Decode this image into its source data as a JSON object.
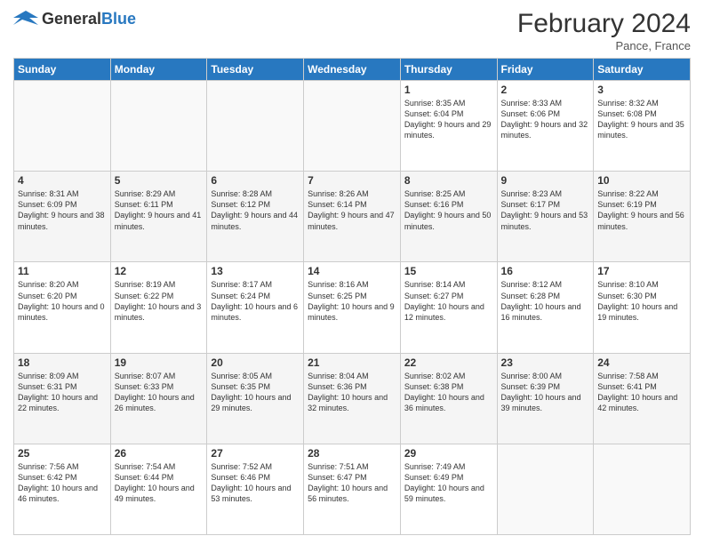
{
  "logo": {
    "general": "General",
    "blue": "Blue"
  },
  "header": {
    "month_year": "February 2024",
    "location": "Pance, France"
  },
  "weekdays": [
    "Sunday",
    "Monday",
    "Tuesday",
    "Wednesday",
    "Thursday",
    "Friday",
    "Saturday"
  ],
  "rows": [
    [
      {
        "day": "",
        "info": ""
      },
      {
        "day": "",
        "info": ""
      },
      {
        "day": "",
        "info": ""
      },
      {
        "day": "",
        "info": ""
      },
      {
        "day": "1",
        "info": "Sunrise: 8:35 AM\nSunset: 6:04 PM\nDaylight: 9 hours and 29 minutes."
      },
      {
        "day": "2",
        "info": "Sunrise: 8:33 AM\nSunset: 6:06 PM\nDaylight: 9 hours and 32 minutes."
      },
      {
        "day": "3",
        "info": "Sunrise: 8:32 AM\nSunset: 6:08 PM\nDaylight: 9 hours and 35 minutes."
      }
    ],
    [
      {
        "day": "4",
        "info": "Sunrise: 8:31 AM\nSunset: 6:09 PM\nDaylight: 9 hours and 38 minutes."
      },
      {
        "day": "5",
        "info": "Sunrise: 8:29 AM\nSunset: 6:11 PM\nDaylight: 9 hours and 41 minutes."
      },
      {
        "day": "6",
        "info": "Sunrise: 8:28 AM\nSunset: 6:12 PM\nDaylight: 9 hours and 44 minutes."
      },
      {
        "day": "7",
        "info": "Sunrise: 8:26 AM\nSunset: 6:14 PM\nDaylight: 9 hours and 47 minutes."
      },
      {
        "day": "8",
        "info": "Sunrise: 8:25 AM\nSunset: 6:16 PM\nDaylight: 9 hours and 50 minutes."
      },
      {
        "day": "9",
        "info": "Sunrise: 8:23 AM\nSunset: 6:17 PM\nDaylight: 9 hours and 53 minutes."
      },
      {
        "day": "10",
        "info": "Sunrise: 8:22 AM\nSunset: 6:19 PM\nDaylight: 9 hours and 56 minutes."
      }
    ],
    [
      {
        "day": "11",
        "info": "Sunrise: 8:20 AM\nSunset: 6:20 PM\nDaylight: 10 hours and 0 minutes."
      },
      {
        "day": "12",
        "info": "Sunrise: 8:19 AM\nSunset: 6:22 PM\nDaylight: 10 hours and 3 minutes."
      },
      {
        "day": "13",
        "info": "Sunrise: 8:17 AM\nSunset: 6:24 PM\nDaylight: 10 hours and 6 minutes."
      },
      {
        "day": "14",
        "info": "Sunrise: 8:16 AM\nSunset: 6:25 PM\nDaylight: 10 hours and 9 minutes."
      },
      {
        "day": "15",
        "info": "Sunrise: 8:14 AM\nSunset: 6:27 PM\nDaylight: 10 hours and 12 minutes."
      },
      {
        "day": "16",
        "info": "Sunrise: 8:12 AM\nSunset: 6:28 PM\nDaylight: 10 hours and 16 minutes."
      },
      {
        "day": "17",
        "info": "Sunrise: 8:10 AM\nSunset: 6:30 PM\nDaylight: 10 hours and 19 minutes."
      }
    ],
    [
      {
        "day": "18",
        "info": "Sunrise: 8:09 AM\nSunset: 6:31 PM\nDaylight: 10 hours and 22 minutes."
      },
      {
        "day": "19",
        "info": "Sunrise: 8:07 AM\nSunset: 6:33 PM\nDaylight: 10 hours and 26 minutes."
      },
      {
        "day": "20",
        "info": "Sunrise: 8:05 AM\nSunset: 6:35 PM\nDaylight: 10 hours and 29 minutes."
      },
      {
        "day": "21",
        "info": "Sunrise: 8:04 AM\nSunset: 6:36 PM\nDaylight: 10 hours and 32 minutes."
      },
      {
        "day": "22",
        "info": "Sunrise: 8:02 AM\nSunset: 6:38 PM\nDaylight: 10 hours and 36 minutes."
      },
      {
        "day": "23",
        "info": "Sunrise: 8:00 AM\nSunset: 6:39 PM\nDaylight: 10 hours and 39 minutes."
      },
      {
        "day": "24",
        "info": "Sunrise: 7:58 AM\nSunset: 6:41 PM\nDaylight: 10 hours and 42 minutes."
      }
    ],
    [
      {
        "day": "25",
        "info": "Sunrise: 7:56 AM\nSunset: 6:42 PM\nDaylight: 10 hours and 46 minutes."
      },
      {
        "day": "26",
        "info": "Sunrise: 7:54 AM\nSunset: 6:44 PM\nDaylight: 10 hours and 49 minutes."
      },
      {
        "day": "27",
        "info": "Sunrise: 7:52 AM\nSunset: 6:46 PM\nDaylight: 10 hours and 53 minutes."
      },
      {
        "day": "28",
        "info": "Sunrise: 7:51 AM\nSunset: 6:47 PM\nDaylight: 10 hours and 56 minutes."
      },
      {
        "day": "29",
        "info": "Sunrise: 7:49 AM\nSunset: 6:49 PM\nDaylight: 10 hours and 59 minutes."
      },
      {
        "day": "",
        "info": ""
      },
      {
        "day": "",
        "info": ""
      }
    ]
  ]
}
